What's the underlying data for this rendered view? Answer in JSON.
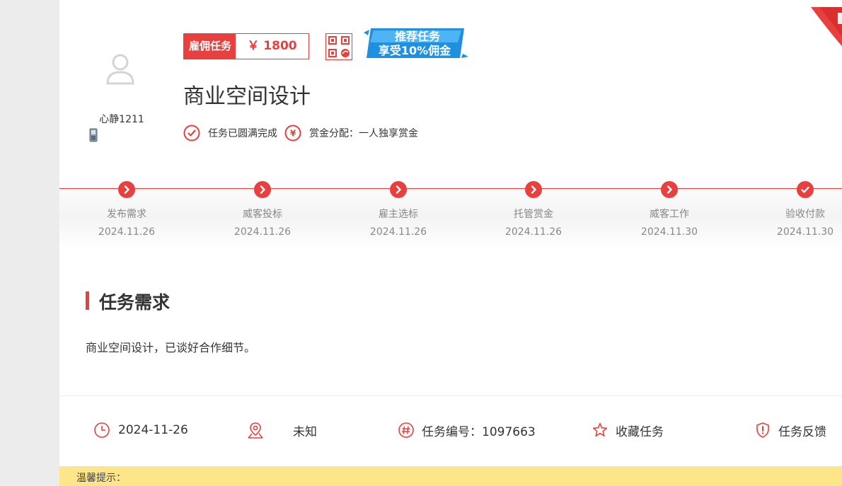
{
  "employer": {
    "name": "心静1211"
  },
  "task": {
    "type_label": "雇佣任务",
    "amount": "￥ 1800",
    "promo_line1": "推荐任务",
    "promo_line2": "享受10%佣金",
    "title": "商业空间设计",
    "status": "任务已圆满完成",
    "reward_mode": "赏金分配：一人独享赏金"
  },
  "timeline": [
    {
      "name": "发布需求",
      "date": "2024.11.26",
      "icon": "chevron-right-icon"
    },
    {
      "name": "威客投标",
      "date": "2024.11.26",
      "icon": "chevron-right-icon"
    },
    {
      "name": "雇主选标",
      "date": "2024.11.26",
      "icon": "chevron-right-icon"
    },
    {
      "name": "托管赏金",
      "date": "2024.11.26",
      "icon": "chevron-right-icon"
    },
    {
      "name": "威客工作",
      "date": "2024.11.30",
      "icon": "chevron-right-icon"
    },
    {
      "name": "验收付款",
      "date": "2024.11.30",
      "icon": "check-icon"
    }
  ],
  "requirements": {
    "heading": "任务需求",
    "description": "商业空间设计，已谈好合作细节。"
  },
  "info_bar": {
    "date": "2024-11-26",
    "location": "未知",
    "task_number": "任务编号：1097663",
    "favorite": "收藏任务",
    "feedback": "任务反馈"
  },
  "tip": {
    "label": "温馨提示："
  },
  "colors": {
    "accent": "#e8403f",
    "tip_bg": "#fde68a"
  }
}
